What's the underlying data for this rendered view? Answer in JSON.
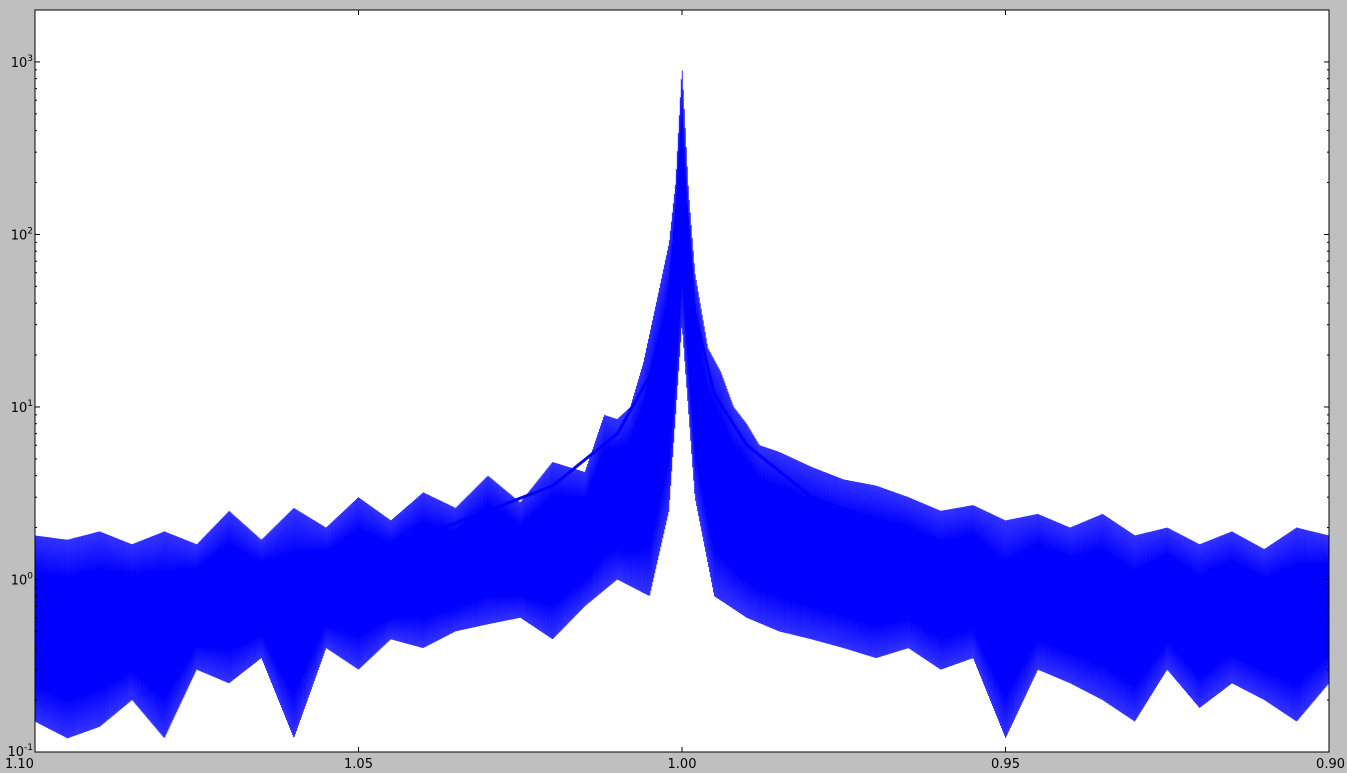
{
  "chart_data": {
    "type": "line",
    "title": "",
    "xlabel": "",
    "ylabel": "",
    "x_scale": "linear",
    "x_axis_reversed": true,
    "xlim": [
      1.1,
      0.9
    ],
    "x_ticks": [
      {
        "value": 1.1,
        "label": "1.10"
      },
      {
        "value": 1.05,
        "label": "1.05"
      },
      {
        "value": 1.0,
        "label": "1.00"
      },
      {
        "value": 0.95,
        "label": "0.95"
      },
      {
        "value": 0.9,
        "label": "0.90"
      }
    ],
    "y_scale": "log",
    "ylim": [
      0.1,
      2000
    ],
    "y_ticks": [
      {
        "value": 0.1,
        "base": "10",
        "exp": "-1"
      },
      {
        "value": 1,
        "base": "10",
        "exp": "0"
      },
      {
        "value": 10,
        "base": "10",
        "exp": "1"
      },
      {
        "value": 100,
        "base": "10",
        "exp": "2"
      },
      {
        "value": 1000,
        "base": "10",
        "exp": "3"
      }
    ],
    "grid": false,
    "legend": "none",
    "line_color": "#0000ff",
    "series": [
      {
        "style": "rapidly oscillating spectrum (upper envelope / lower envelope)",
        "upper_envelope": {
          "x": [
            1.1,
            1.095,
            1.09,
            1.085,
            1.08,
            1.075,
            1.07,
            1.065,
            1.06,
            1.055,
            1.05,
            1.045,
            1.04,
            1.035,
            1.03,
            1.025,
            1.02,
            1.015,
            1.012,
            1.01,
            1.008,
            1.006,
            1.004,
            1.002,
            1.001,
            1.0,
            0.999,
            0.998,
            0.996,
            0.994,
            0.992,
            0.99,
            0.988,
            0.985,
            0.98,
            0.975,
            0.97,
            0.965,
            0.96,
            0.955,
            0.95,
            0.945,
            0.94,
            0.935,
            0.93,
            0.925,
            0.92,
            0.915,
            0.91,
            0.905,
            0.9
          ],
          "y": [
            1.8,
            1.7,
            1.9,
            1.6,
            1.9,
            1.6,
            2.5,
            1.7,
            2.6,
            2.0,
            3.0,
            2.2,
            3.2,
            2.6,
            4.0,
            2.8,
            4.8,
            4.2,
            9.0,
            8.5,
            10.0,
            18.0,
            40.0,
            90.0,
            200.0,
            950.0,
            180.0,
            60.0,
            22.0,
            16.0,
            10.0,
            8.0,
            6.0,
            5.5,
            4.5,
            3.8,
            3.5,
            3.0,
            2.5,
            2.7,
            2.2,
            2.4,
            2.0,
            2.4,
            1.8,
            2.0,
            1.6,
            1.9,
            1.5,
            2.0,
            1.8
          ]
        },
        "lower_envelope": {
          "x": [
            1.1,
            1.095,
            1.09,
            1.085,
            1.08,
            1.075,
            1.07,
            1.065,
            1.06,
            1.055,
            1.05,
            1.045,
            1.04,
            1.035,
            1.03,
            1.025,
            1.02,
            1.015,
            1.01,
            1.005,
            1.002,
            1.0,
            0.998,
            0.995,
            0.99,
            0.985,
            0.98,
            0.975,
            0.97,
            0.965,
            0.96,
            0.955,
            0.95,
            0.945,
            0.94,
            0.935,
            0.93,
            0.925,
            0.92,
            0.915,
            0.91,
            0.905,
            0.9
          ],
          "y": [
            0.15,
            0.12,
            0.14,
            0.2,
            0.12,
            0.3,
            0.25,
            0.35,
            0.12,
            0.4,
            0.3,
            0.45,
            0.4,
            0.5,
            0.55,
            0.6,
            0.45,
            0.7,
            1.0,
            0.8,
            2.5,
            30.0,
            3.0,
            0.8,
            0.6,
            0.5,
            0.45,
            0.4,
            0.35,
            0.4,
            0.3,
            0.35,
            0.12,
            0.3,
            0.25,
            0.2,
            0.15,
            0.3,
            0.18,
            0.25,
            0.2,
            0.15,
            0.25
          ]
        },
        "mid_line": {
          "x": [
            1.1,
            1.09,
            1.08,
            1.07,
            1.06,
            1.05,
            1.04,
            1.03,
            1.02,
            1.01,
            1.005,
            1.002,
            1.0,
            0.998,
            0.995,
            0.99,
            0.98,
            0.97,
            0.96,
            0.95,
            0.94,
            0.93,
            0.92,
            0.91,
            0.9
          ],
          "y": [
            0.7,
            0.8,
            0.8,
            0.9,
            1.1,
            1.3,
            1.8,
            2.5,
            3.5,
            7.0,
            15.0,
            40.0,
            300.0,
            35.0,
            12.0,
            6.0,
            3.0,
            2.2,
            1.6,
            1.3,
            1.1,
            0.9,
            0.8,
            0.8,
            0.7
          ]
        }
      }
    ]
  }
}
